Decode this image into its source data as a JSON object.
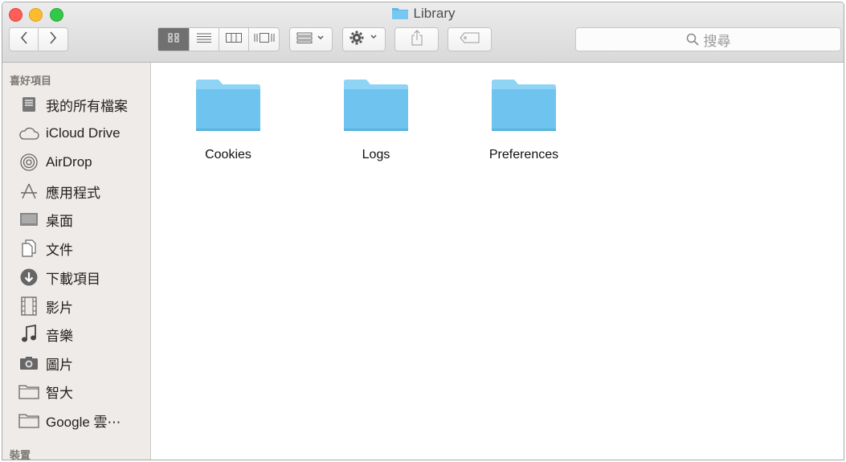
{
  "window": {
    "title": "Library"
  },
  "toolbar": {
    "back_icon": "chevron-left-icon",
    "forward_icon": "chevron-right-icon",
    "view_modes": [
      "icon-view-icon",
      "list-view-icon",
      "column-view-icon",
      "coverflow-view-icon"
    ],
    "active_view": "icon-view-icon",
    "arrange_icon": "arrange-icon",
    "action_icon": "gear-icon",
    "share_icon": "share-icon",
    "tag_icon": "tag-icon"
  },
  "search": {
    "placeholder": "搜尋"
  },
  "sidebar": {
    "favorites_header": "喜好項目",
    "items": [
      {
        "label": "我的所有檔案",
        "icon": "all-files-icon"
      },
      {
        "label": "iCloud Drive",
        "icon": "cloud-icon"
      },
      {
        "label": "AirDrop",
        "icon": "airdrop-icon"
      },
      {
        "label": "應用程式",
        "icon": "applications-icon"
      },
      {
        "label": "桌面",
        "icon": "desktop-icon"
      },
      {
        "label": "文件",
        "icon": "documents-icon"
      },
      {
        "label": "下載項目",
        "icon": "downloads-icon"
      },
      {
        "label": "影片",
        "icon": "movies-icon"
      },
      {
        "label": "音樂",
        "icon": "music-icon"
      },
      {
        "label": "圖片",
        "icon": "pictures-icon"
      },
      {
        "label": "智大",
        "icon": "folder-icon"
      },
      {
        "label": "Google 雲⋯",
        "icon": "folder-icon"
      }
    ],
    "devices_header": "裝置"
  },
  "files": [
    {
      "name": "Cookies",
      "icon": "folder-icon"
    },
    {
      "name": "Logs",
      "icon": "folder-icon"
    },
    {
      "name": "Preferences",
      "icon": "folder-icon"
    }
  ],
  "colors": {
    "folder": "#6ec4ee",
    "folder_tab": "#8fd3f5",
    "active_segment": "#707070"
  }
}
